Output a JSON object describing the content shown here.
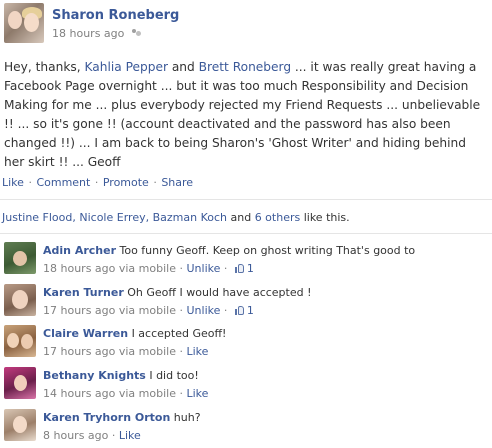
{
  "post": {
    "author": "Sharon Roneberg",
    "time": "18 hours ago",
    "audience_icon": "friends-icon",
    "body": {
      "text1": "Hey, thanks, ",
      "mention1": "Kahlia Pepper",
      "text2": " and ",
      "mention2": "Brett Roneberg",
      "text3": " ... it was really great having a Facebook Page overnight ... but it was too much Responsibility and Decision Making for me ... plus everybody rejected my Friend Requests ... unbelievable !! ... so it's gone !! (account deactivated and the password has also been changed !!) ... I am back to being Sharon's 'Ghost Writer' and hiding behind her skirt !! ... Geoff"
    },
    "actions": {
      "like": "Like",
      "comment": "Comment",
      "promote": "Promote",
      "share": "Share",
      "separator": "·"
    },
    "likes": {
      "names": "Justine Flood, Nicole Errey, Bazman Koch",
      "and": " and ",
      "others": "6 others",
      "suffix": " like this."
    }
  },
  "comments": [
    {
      "name": "Adin Archer",
      "text": "Too funny Geoff. Keep on ghost writing That's good to",
      "time": "18 hours ago via mobile",
      "action": "Unlike",
      "likes": "1"
    },
    {
      "name": "Karen Turner",
      "text": "Oh Geoff I would have accepted !",
      "time": "17 hours ago via mobile",
      "action": "Unlike",
      "likes": "1"
    },
    {
      "name": "Claire Warren",
      "text": "I accepted Geoff!",
      "time": "17 hours ago via mobile",
      "action": "Like",
      "likes": ""
    },
    {
      "name": "Bethany Knights",
      "text": "I did too!",
      "time": "14 hours ago via mobile",
      "action": "Like",
      "likes": ""
    },
    {
      "name": "Karen Tryhorn Orton",
      "text": "huh?",
      "time": "8 hours ago",
      "action": "Like",
      "likes": ""
    }
  ],
  "colors": {
    "link": "#3b5998",
    "text": "#333333",
    "meta": "#808080",
    "divider": "#e5e5e5"
  }
}
